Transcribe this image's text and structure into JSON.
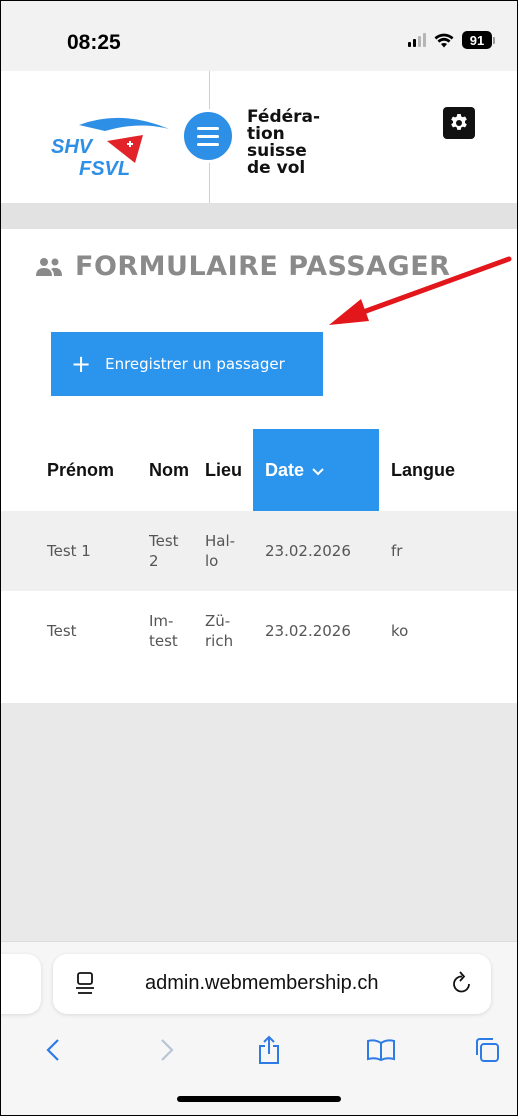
{
  "status_bar": {
    "time": "08:25",
    "battery_level": "91",
    "signal_bars_active": 2,
    "signal_bars_total": 4,
    "icons": [
      "signal-icon",
      "wifi-icon",
      "battery-icon"
    ]
  },
  "header": {
    "logo": {
      "line1": "SHV",
      "line2": "FSVL"
    },
    "brand_lines": [
      "Fédéra-",
      "tion",
      "suisse",
      "de vol"
    ],
    "icons": [
      "menu-icon",
      "gear-icon"
    ],
    "accent_color": "#2e8fe6",
    "logo_red": "#e3232a"
  },
  "page": {
    "title": "FORMULAIRE PASSAGER",
    "title_icon": "users-icon",
    "add_button_label": "Enregistrer un passager",
    "add_button_icon": "plus-icon",
    "button_color": "#2b95ee",
    "annotation": {
      "type": "red-arrow",
      "color": "#e3171b"
    }
  },
  "table": {
    "columns": [
      {
        "label": "Prénom",
        "sorted": false
      },
      {
        "label": "Nom",
        "sorted": false
      },
      {
        "label": "Lieu",
        "sorted": false
      },
      {
        "label": "Date",
        "sorted": true,
        "sort_icon": "chevron-down-icon"
      },
      {
        "label": "Langue",
        "sorted": false
      }
    ],
    "rows": [
      {
        "prenom": "Test 1",
        "nom": [
          "Test",
          "2"
        ],
        "lieu": [
          "Hal-",
          "lo"
        ],
        "date": "23.02.2026",
        "langue": "fr"
      },
      {
        "prenom": "Test",
        "nom": [
          "Im-",
          "test"
        ],
        "lieu": [
          "Zü-",
          "rich"
        ],
        "date": "23.02.2026",
        "langue": "ko"
      }
    ]
  },
  "browser": {
    "url": "admin.webmembership.ch",
    "icons": [
      "page-menu-icon",
      "reload-icon",
      "back-icon",
      "forward-icon",
      "share-icon",
      "bookmarks-icon",
      "tabs-icon"
    ]
  }
}
